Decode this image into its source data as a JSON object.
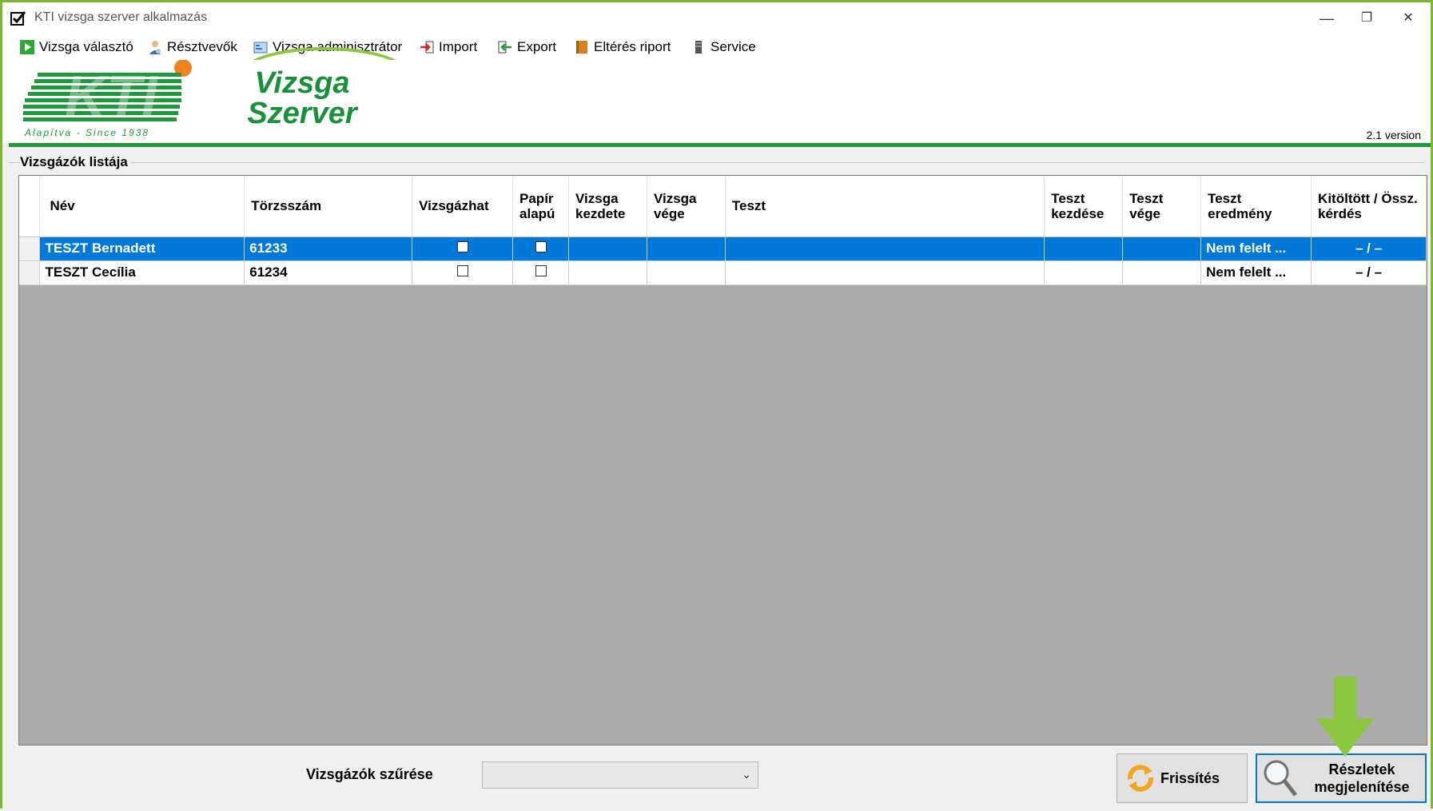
{
  "window": {
    "title": "KTI vizsga szerver alkalmazás",
    "minimize": "—",
    "restore": "❐",
    "close": "✕"
  },
  "menu": {
    "items": [
      {
        "label": "Vizsga választó",
        "icon": "play-icon"
      },
      {
        "label": "Résztvevők",
        "icon": "person-icon"
      },
      {
        "label": "Vizsga adminisztrátor",
        "icon": "admin-icon"
      },
      {
        "label": "Import",
        "icon": "import-icon"
      },
      {
        "label": "Export",
        "icon": "export-icon"
      },
      {
        "label": "Eltérés riport",
        "icon": "book-icon"
      },
      {
        "label": "Service",
        "icon": "service-icon"
      }
    ]
  },
  "banner": {
    "logo_text": "KTI",
    "logo_tagline": "Alapítva - Since 1938",
    "app_title_line1": "Vizsga",
    "app_title_line2": "Szerver",
    "version": "2.1 version"
  },
  "list": {
    "title": "Vizsgázók listája",
    "columns": [
      "Név",
      "Törzsszám",
      "Vizsgázhat",
      "Papír alapú",
      "Vizsga kezdete",
      "Vizsga vége",
      "Teszt",
      "Teszt kezdése",
      "Teszt vége",
      "Teszt eredmény",
      "Kitöltött / Össz. kérdés"
    ],
    "rows": [
      {
        "name": "TESZT Bernadett",
        "id": "61233",
        "can_exam": false,
        "paper": false,
        "exam_start": "",
        "exam_end": "",
        "test": "",
        "test_start": "",
        "test_end": "",
        "result": "Nem felelt ...",
        "filled": "– / –",
        "selected": true
      },
      {
        "name": "TESZT Cecília",
        "id": "61234",
        "can_exam": false,
        "paper": false,
        "exam_start": "",
        "exam_end": "",
        "test": "",
        "test_start": "",
        "test_end": "",
        "result": "Nem felelt ...",
        "filled": "– / –",
        "selected": false
      }
    ]
  },
  "filter": {
    "label": "Vizsgázók szűrése",
    "value": ""
  },
  "buttons": {
    "refresh": "Frissítés",
    "details_line1": "Részletek",
    "details_line2": "megjelenítése"
  },
  "colors": {
    "accent_green": "#8dc63f",
    "logo_green": "#19913a",
    "selection_blue": "#0078d7"
  }
}
